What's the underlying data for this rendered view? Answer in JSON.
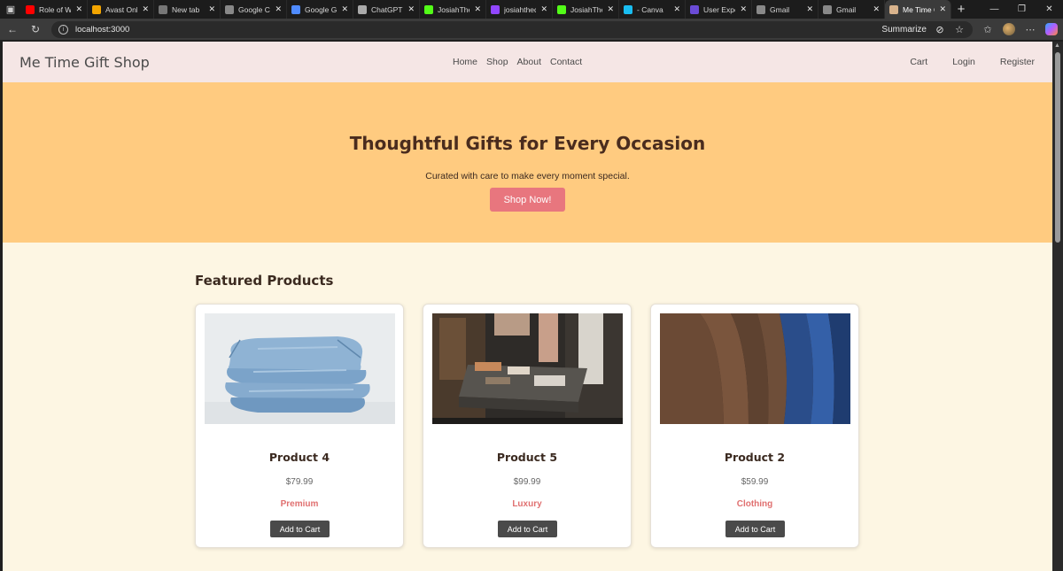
{
  "browser": {
    "tabs": [
      {
        "title": "Role of Wo",
        "color": "#ff0000"
      },
      {
        "title": "Avast Onlin",
        "color": "#f3a500"
      },
      {
        "title": "New tab",
        "color": "#777777"
      },
      {
        "title": "Google Ca",
        "color": "#888888"
      },
      {
        "title": "Google Ge",
        "color": "#4f8bff"
      },
      {
        "title": "ChatGPT",
        "color": "#aaaaaa"
      },
      {
        "title": "JosiahTheE",
        "color": "#53fc18"
      },
      {
        "title": "josiahthed",
        "color": "#9146ff"
      },
      {
        "title": "JosiahTheE",
        "color": "#53fc18"
      },
      {
        "title": "- Canva",
        "color": "#19bdf0"
      },
      {
        "title": "User Exper",
        "color": "#6a4bd6"
      },
      {
        "title": "Gmail",
        "color": "#888888"
      },
      {
        "title": "Gmail",
        "color": "#888888"
      },
      {
        "title": "Me Time G",
        "color": "#d9b38c"
      }
    ],
    "url": "localhost:3000",
    "summarize_label": "Summarize"
  },
  "site": {
    "brand": "Me Time Gift Shop",
    "nav_center": [
      "Home",
      "Shop",
      "About",
      "Contact"
    ],
    "nav_right": [
      "Cart",
      "Login",
      "Register"
    ],
    "hero": {
      "title": "Thoughtful Gifts for Every Occasion",
      "subtitle": "Curated with care to make every moment special.",
      "cta": "Shop Now!"
    },
    "featured_title": "Featured Products",
    "products": [
      {
        "name": "Product 4",
        "price": "$79.99",
        "category": "Premium",
        "button": "Add to Cart",
        "image": "jeans-stack"
      },
      {
        "name": "Product 5",
        "price": "$99.99",
        "category": "Luxury",
        "button": "Add to Cart",
        "image": "clothing-store"
      },
      {
        "name": "Product 2",
        "price": "$59.99",
        "category": "Clothing",
        "button": "Add to Cart",
        "image": "coats-rack"
      }
    ]
  },
  "colors": {
    "nav_bg": "#f5e6e5",
    "hero_bg": "#ffcb80",
    "page_bg": "#fdf6e3",
    "cta_bg": "#e8767e",
    "category_text": "#e07070",
    "button_bg": "#4a4a4a"
  }
}
